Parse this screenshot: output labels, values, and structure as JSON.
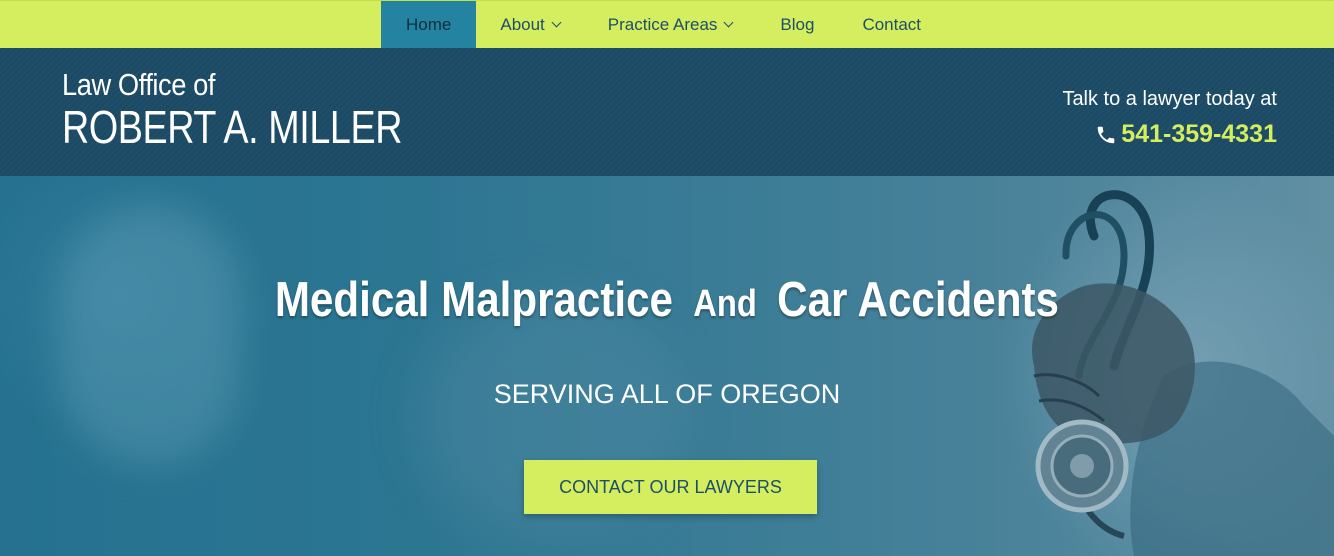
{
  "nav": {
    "items": [
      {
        "label": "Home",
        "active": true,
        "has_dropdown": false
      },
      {
        "label": "About",
        "active": false,
        "has_dropdown": true
      },
      {
        "label": "Practice Areas",
        "active": false,
        "has_dropdown": true
      },
      {
        "label": "Blog",
        "active": false,
        "has_dropdown": false
      },
      {
        "label": "Contact",
        "active": false,
        "has_dropdown": false
      }
    ]
  },
  "header": {
    "logo_line1": "Law Office of",
    "logo_line2": "ROBERT A. MILLER",
    "talk_text": "Talk to a lawyer today at",
    "phone": "541-359-4331",
    "phone_icon": "phone-icon"
  },
  "hero": {
    "title_part1": "Medical Malpractice",
    "title_and": "And",
    "title_part2": "Car Accidents",
    "subtitle": "SERVING ALL OF OREGON",
    "cta_label": "CONTACT OUR LAWYERS"
  },
  "colors": {
    "accent": "#d4ee5f",
    "header_bg": "#1b4a64",
    "nav_active": "#2383a0",
    "text_dark": "#1f4f68"
  }
}
